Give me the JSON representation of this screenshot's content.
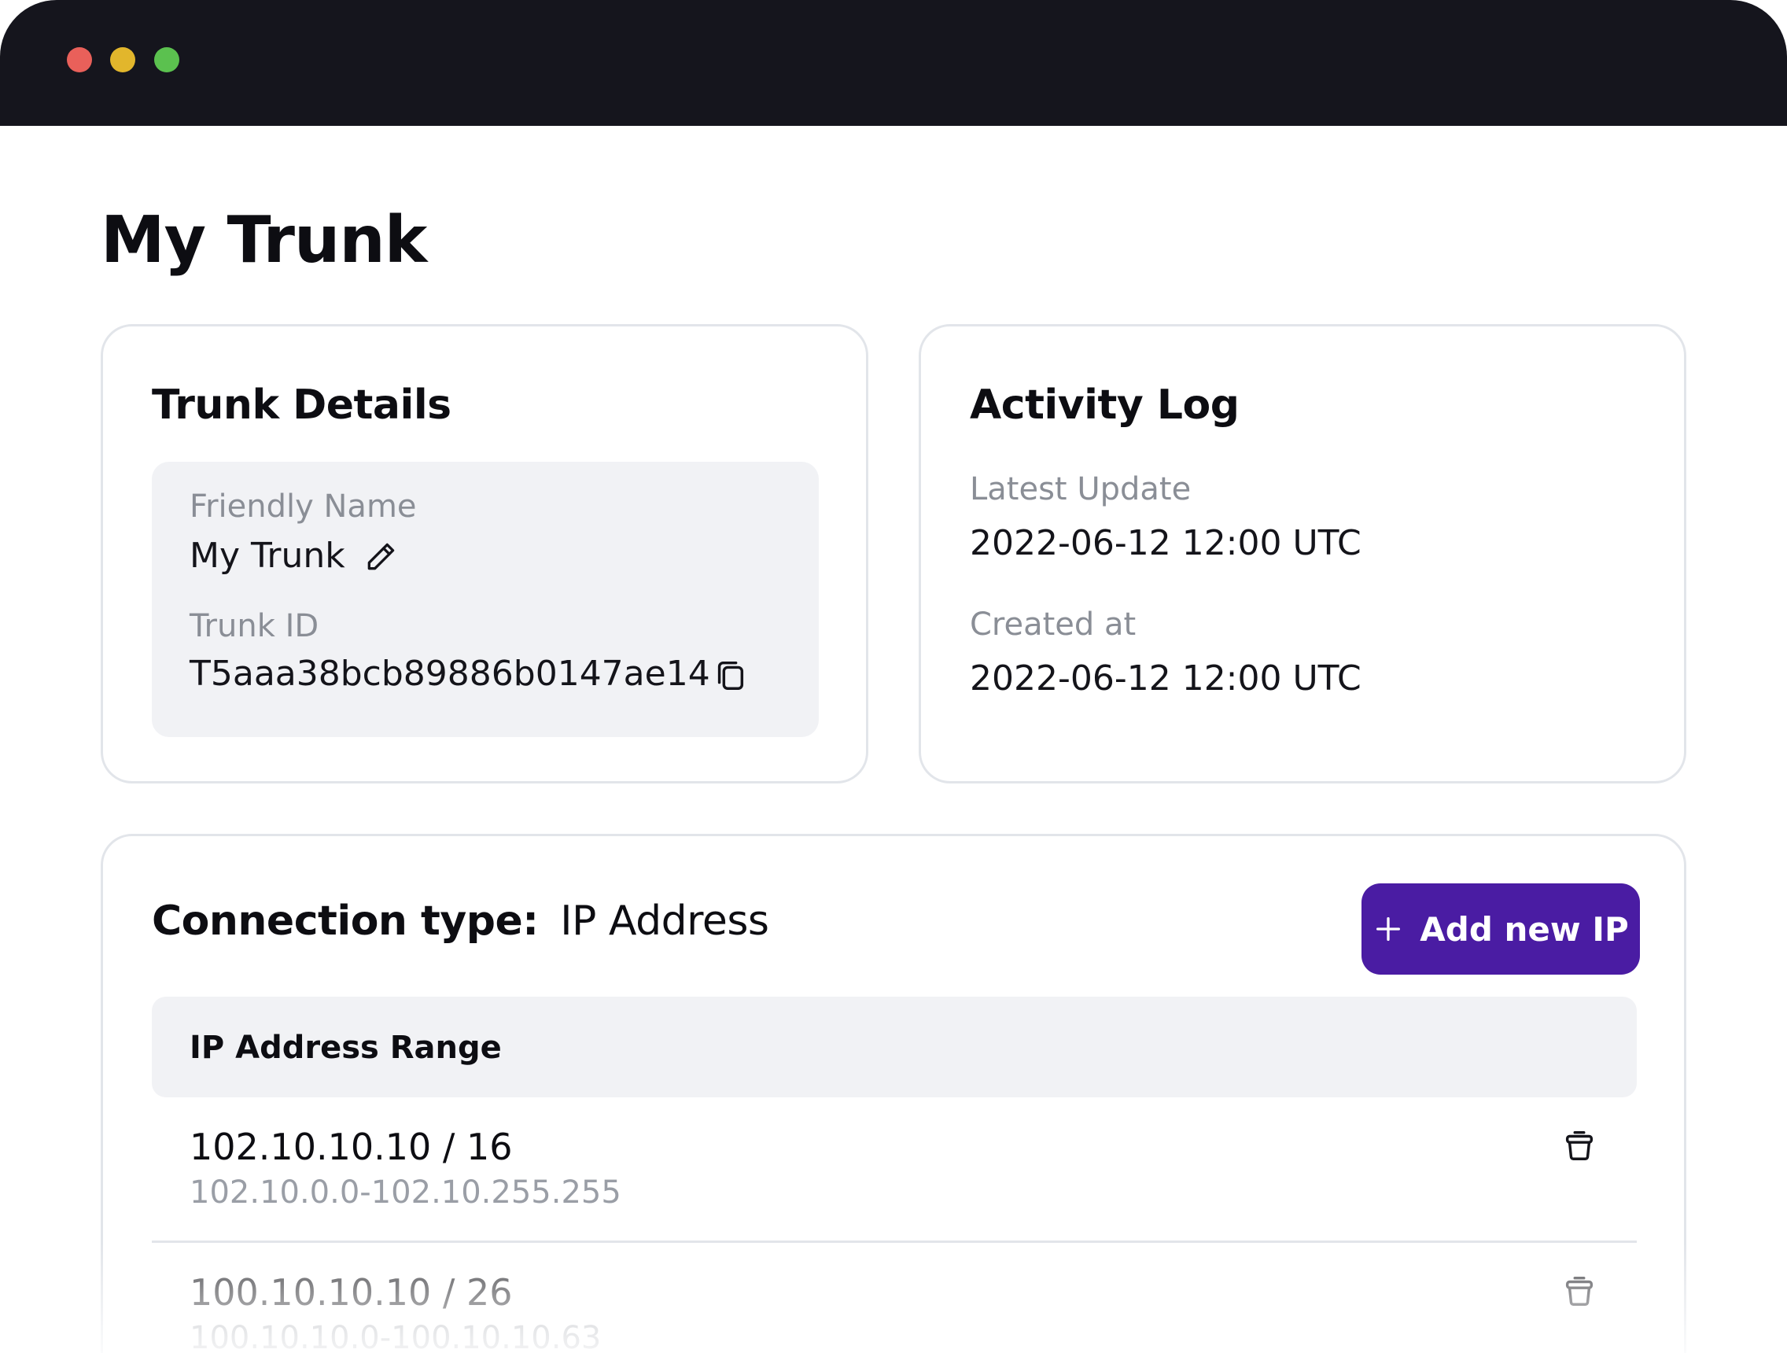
{
  "window": {
    "controls": [
      "close",
      "minimize",
      "maximize"
    ]
  },
  "page": {
    "title": "My Trunk"
  },
  "trunk_details": {
    "heading": "Trunk Details",
    "friendly_name_label": "Friendly Name",
    "friendly_name_value": "My Trunk",
    "trunk_id_label": "Trunk ID",
    "trunk_id_value": "T5aaa38bcb89886b0147ae14",
    "icons": {
      "edit": "pencil-icon",
      "copy": "copy-icon"
    }
  },
  "activity_log": {
    "heading": "Activity Log",
    "latest_update_label": "Latest Update",
    "latest_update_value": "2022-06-12 12:00 UTC",
    "created_at_label": "Created at",
    "created_at_value": "2022-06-12 12:00 UTC"
  },
  "connection": {
    "type_label": "Connection type:",
    "type_value": "IP Address",
    "add_button_label": "Add new IP",
    "table_header": "IP Address Range",
    "rows": [
      {
        "cidr": "102.10.10.10 / 16",
        "range": "102.10.0.0-102.10.255.255"
      },
      {
        "cidr": "100.10.10.10 / 26",
        "range": "100.10.10.0-100.10.10.63"
      }
    ]
  },
  "colors": {
    "titlebar": "#15151d",
    "accent": "#4a1ca3",
    "close": "#e9605a",
    "minimize": "#e2b62c",
    "maximize": "#5bc14f"
  }
}
